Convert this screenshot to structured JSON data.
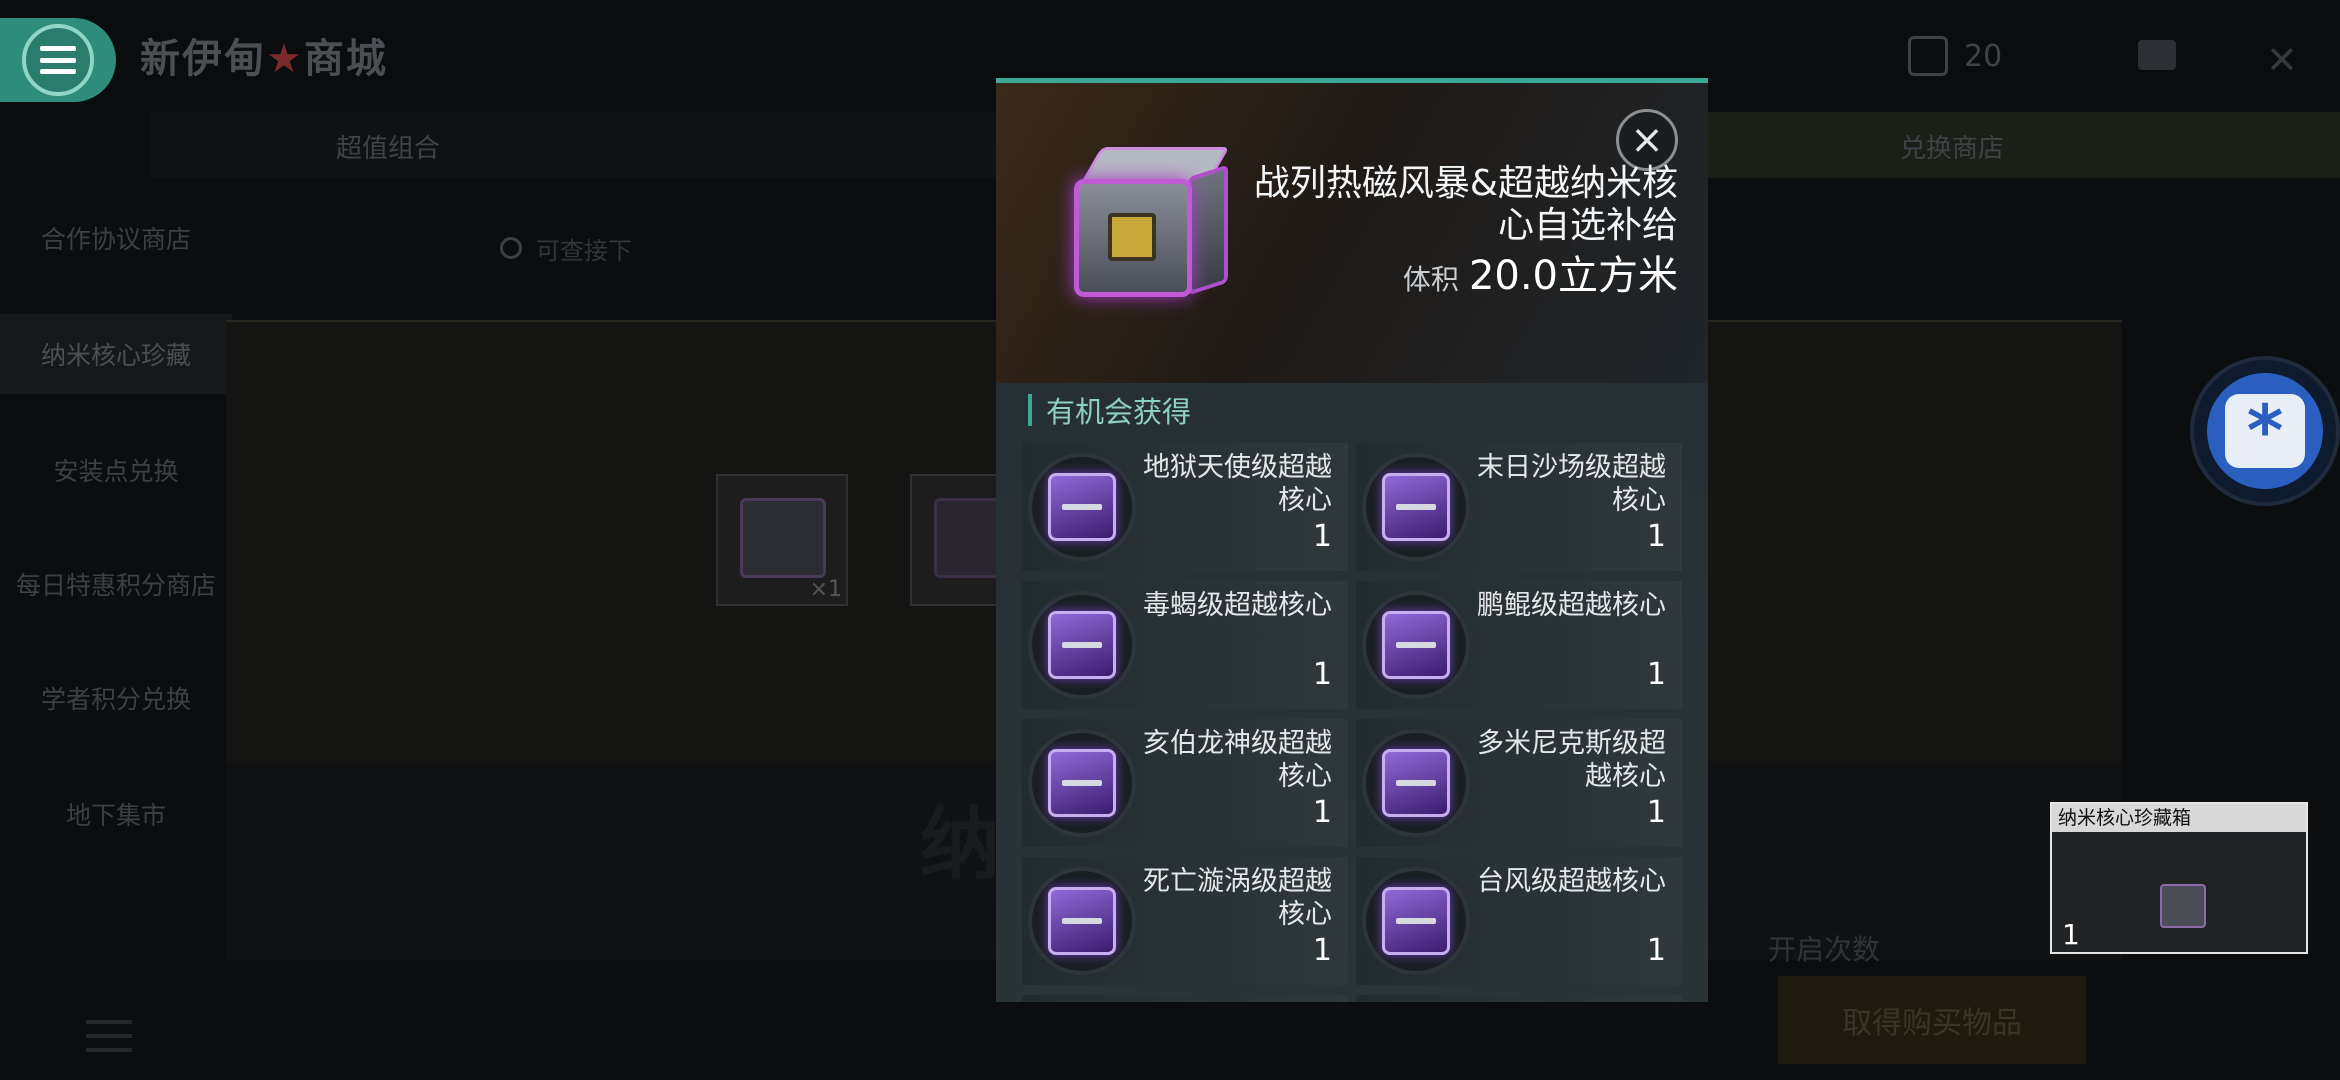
{
  "app": {
    "shop_title_prefix": "新伊甸",
    "shop_title_star": "★",
    "shop_title_suffix": "商城",
    "currency_value": "20"
  },
  "tabs": [
    {
      "label": "超值组合"
    },
    {
      "label": "兑换商店"
    }
  ],
  "left_nav": [
    {
      "label": "合作协议商店"
    },
    {
      "label": "纳米核心珍藏"
    },
    {
      "label": "安装点兑换"
    },
    {
      "label": "每日特惠积分商店"
    },
    {
      "label": "学者积分兑换"
    },
    {
      "label": "地下集市"
    }
  ],
  "search": {
    "placeholder": "可查接下"
  },
  "shop_items": [
    {
      "qty": "×1"
    },
    {
      "qty": "×"
    }
  ],
  "background_text": {
    "banner": "纳",
    "open_count_label": "开启次数",
    "buy_button": "取得购买物品"
  },
  "mini_window": {
    "title": "纳米核心珍藏箱",
    "count": "1"
  },
  "modal": {
    "title": "战列热磁风暴&超越纳米核心自选补给",
    "volume_label": "体积",
    "volume_value": "20.0立方米",
    "section_title": "有机会获得",
    "rewards": [
      {
        "name": "地狱天使级超越核心",
        "count": "1"
      },
      {
        "name": "末日沙场级超越核心",
        "count": "1"
      },
      {
        "name": "毒蝎级超越核心",
        "count": "1"
      },
      {
        "name": "鹏鲲级超越核心",
        "count": "1"
      },
      {
        "name": "亥伯龙神级超越核心",
        "count": "1"
      },
      {
        "name": "多米尼克斯级超越核心",
        "count": "1"
      },
      {
        "name": "死亡漩涡级超越核心",
        "count": "1"
      },
      {
        "name": "台风级超越核心",
        "count": "1"
      }
    ]
  },
  "colors": {
    "accent": "#3ea897",
    "gem": "#8f6ad8",
    "float_button": "#2a5fbf"
  }
}
